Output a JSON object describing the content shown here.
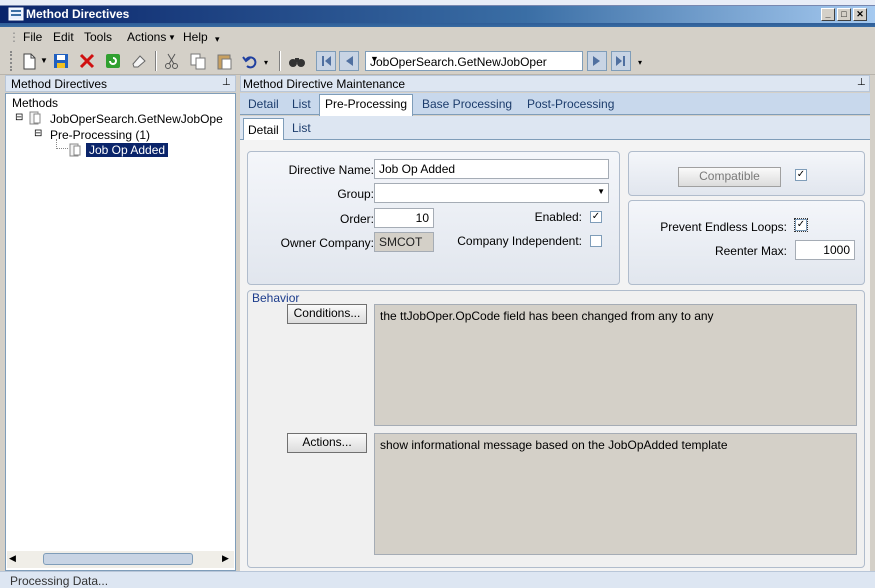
{
  "window": {
    "title": "Method Directives"
  },
  "menu": {
    "items": [
      "File",
      "Edit",
      "Tools",
      "Actions",
      "Help"
    ]
  },
  "toolbar": {
    "method_value": "JobOperSearch.GetNewJobOper"
  },
  "left_panel": {
    "header": "Method Directives",
    "tree": {
      "root": "Methods",
      "method": "JobOperSearch.GetNewJobOpe",
      "group": "Pre-Processing (1)",
      "item": "Job Op Added"
    }
  },
  "right_panel": {
    "header": "Method Directive Maintenance",
    "tabs": [
      "Detail",
      "List",
      "Pre-Processing",
      "Base Processing",
      "Post-Processing"
    ],
    "subtabs": [
      "Detail",
      "List"
    ]
  },
  "form": {
    "directive_name_label": "Directive Name:",
    "directive_name": "Job Op Added",
    "group_label": "Group:",
    "group_value": "",
    "order_label": "Order:",
    "order": "10",
    "enabled_label": "Enabled:",
    "enabled": true,
    "owner_company_label": "Owner Company:",
    "owner_company": "SMCOT",
    "company_independent_label": "Company Independent:",
    "company_independent": false,
    "compatible_label": "Compatible",
    "compatible": true,
    "prevent_loops_label": "Prevent Endless Loops:",
    "prevent_loops": true,
    "reenter_max_label": "Reenter Max:",
    "reenter_max": "1000"
  },
  "behavior": {
    "title": "Behavior",
    "conditions_label": "Conditions...",
    "conditions_text": "the ttJobOper.OpCode field has been changed from any to any",
    "actions_label": "Actions...",
    "actions_text": "show informational message based on the JobOpAdded template"
  },
  "status": {
    "text": "Processing Data..."
  },
  "colors": {
    "title_bar": "#0a246a",
    "tab_active": "#ffffff",
    "tree_selected": "#0a246a"
  }
}
